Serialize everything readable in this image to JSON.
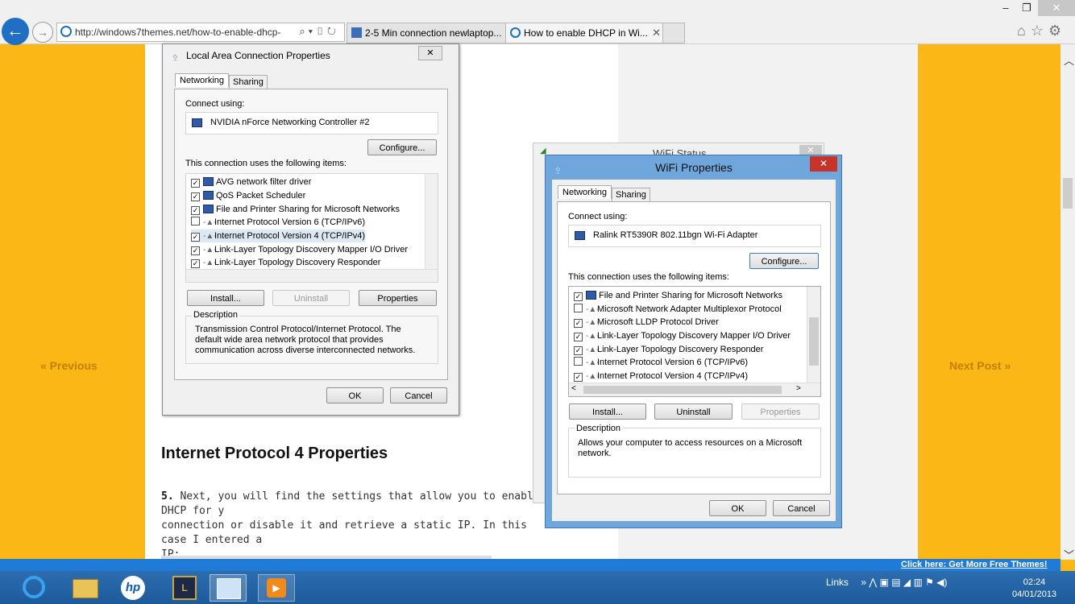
{
  "browser": {
    "address": "http://windows7themes.net/how-to-enable-dhcp-",
    "tabs": [
      {
        "label": "2-5 Min connection newlaptop..."
      },
      {
        "label": "How to enable DHCP in Wi..."
      }
    ],
    "window_buttons": [
      "–",
      "❐",
      "✕"
    ]
  },
  "page": {
    "prev_link": "« Previous",
    "next_link": "Next Post »",
    "heading": "Internet Protocol 4 Properties",
    "step_number": "5.",
    "paragraph_lines": [
      " Next, you will find the settings that allow you to enable DHCP for y",
      "connection or disable it and retrieve a static IP. In this case I entered a",
      "IP:"
    ],
    "footer_link": "Click here: Get More Free Themes!"
  },
  "lan_dialog": {
    "title": "Local Area Connection  Properties",
    "tabs": [
      "Networking",
      "Sharing"
    ],
    "connect_using_label": "Connect using:",
    "adapter": "NVIDIA nForce Networking Controller #2",
    "configure": "Configure...",
    "items_label": "This connection uses the following items:",
    "items": [
      {
        "label": "AVG network filter driver",
        "checked": true,
        "icon": "net"
      },
      {
        "label": "QoS Packet Scheduler",
        "checked": true,
        "icon": "net"
      },
      {
        "label": "File and Printer Sharing for Microsoft Networks",
        "checked": true,
        "icon": "net"
      },
      {
        "label": "Internet Protocol Version 6 (TCP/IPv6)",
        "checked": false,
        "icon": "proto"
      },
      {
        "label": "Internet Protocol Version 4 (TCP/IPv4)",
        "checked": true,
        "icon": "proto"
      },
      {
        "label": "Link-Layer Topology Discovery Mapper I/O Driver",
        "checked": true,
        "icon": "proto"
      },
      {
        "label": "Link-Layer Topology Discovery Responder",
        "checked": true,
        "icon": "proto"
      }
    ],
    "install": "Install...",
    "uninstall": "Uninstall",
    "properties": "Properties",
    "description_label": "Description",
    "description": "Transmission Control Protocol/Internet Protocol. The default wide area network protocol that provides communication across diverse interconnected networks.",
    "ok": "OK",
    "cancel": "Cancel"
  },
  "wifi_status": {
    "title": "WiFi Status"
  },
  "wifi_dialog": {
    "title": "WiFi Properties",
    "tabs": [
      "Networking",
      "Sharing"
    ],
    "connect_using_label": "Connect using:",
    "adapter": "Ralink RT5390R 802.11bgn Wi-Fi Adapter",
    "configure": "Configure...",
    "items_label": "This connection uses the following items:",
    "items": [
      {
        "label": "File and Printer Sharing for Microsoft Networks",
        "checked": true,
        "icon": "net"
      },
      {
        "label": "Microsoft Network Adapter Multiplexor Protocol",
        "checked": false,
        "icon": "proto"
      },
      {
        "label": "Microsoft LLDP Protocol Driver",
        "checked": true,
        "icon": "proto"
      },
      {
        "label": "Link-Layer Topology Discovery Mapper I/O Driver",
        "checked": true,
        "icon": "proto"
      },
      {
        "label": "Link-Layer Topology Discovery Responder",
        "checked": true,
        "icon": "proto"
      },
      {
        "label": "Internet Protocol Version 6 (TCP/IPv6)",
        "checked": false,
        "icon": "proto"
      },
      {
        "label": "Internet Protocol Version 4 (TCP/IPv4)",
        "checked": true,
        "icon": "proto"
      }
    ],
    "install": "Install...",
    "uninstall": "Uninstall",
    "properties": "Properties",
    "description_label": "Description",
    "description": "Allows your computer to access resources on a Microsoft network.",
    "ok": "OK",
    "cancel": "Cancel"
  },
  "taskbar": {
    "links_label": "Links",
    "time": "02:24",
    "date": "04/01/2013"
  },
  "colors": {
    "page_bg": "#fbb716",
    "accent_blue": "#1f7bd6",
    "close_red": "#c7342a",
    "wifi_frame": "#6fa7dc"
  }
}
